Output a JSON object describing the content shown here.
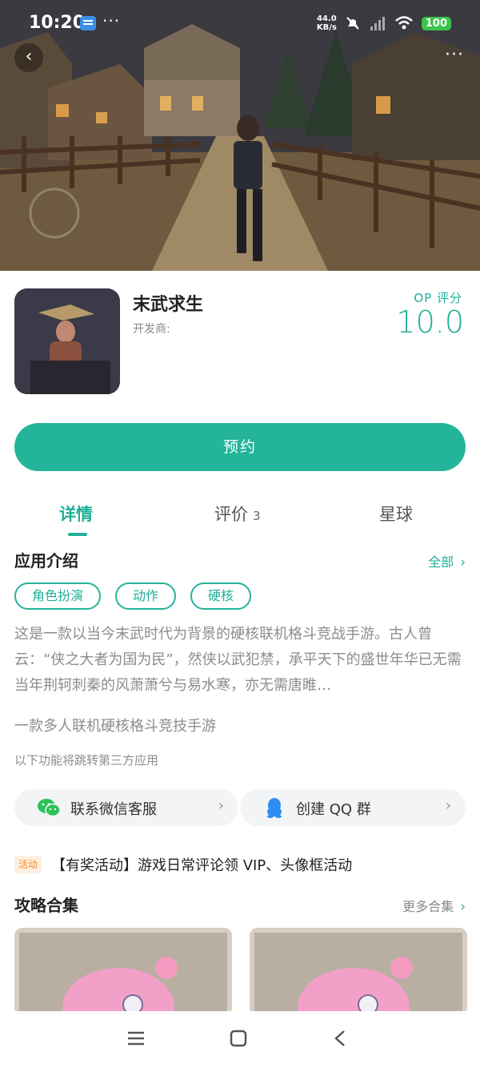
{
  "status_bar": {
    "time": "10:20",
    "net_speed_value": "44.0",
    "net_speed_unit": "KB/s",
    "battery": "100",
    "dots": "···"
  },
  "header": {
    "back_icon": "back-chevron-icon",
    "more_label": "···"
  },
  "app": {
    "name": "末武求生",
    "developer_label": "开发商:",
    "score_label": "OP 评分",
    "score_value": "10.0"
  },
  "reserve_button": {
    "label": "预约"
  },
  "tabs": [
    {
      "label": "详情",
      "active": true
    },
    {
      "label": "评价",
      "count": "3"
    },
    {
      "label": "星球"
    }
  ],
  "intro": {
    "title": "应用介绍",
    "all_label": "全部",
    "tags": [
      "角色扮演",
      "动作",
      "硬核"
    ],
    "description": "这是一款以当今末武时代为背景的硬核联机格斗竞战手游。古人曾云：“侠之大者为国为民”，然侠以武犯禁，承平天下的盛世年华已无需当年荆轲刺秦的风萧萧兮与易水寒，亦无需唐睢…",
    "subtitle": "一款多人联机硬核格斗竞技手游",
    "note": "以下功能将跳转第三方应用"
  },
  "services": [
    {
      "label": "联系微信客服",
      "icon": "wechat-icon"
    },
    {
      "label": "创建 QQ 群",
      "icon": "qq-icon"
    }
  ],
  "activity": {
    "badge": "活动",
    "text": "【有奖活动】游戏日常评论领 VIP、头像框活动"
  },
  "guides": {
    "title": "攻略合集",
    "more_label": "更多合集"
  },
  "colors": {
    "accent": "#23b49a",
    "activity": "#f08a26"
  }
}
